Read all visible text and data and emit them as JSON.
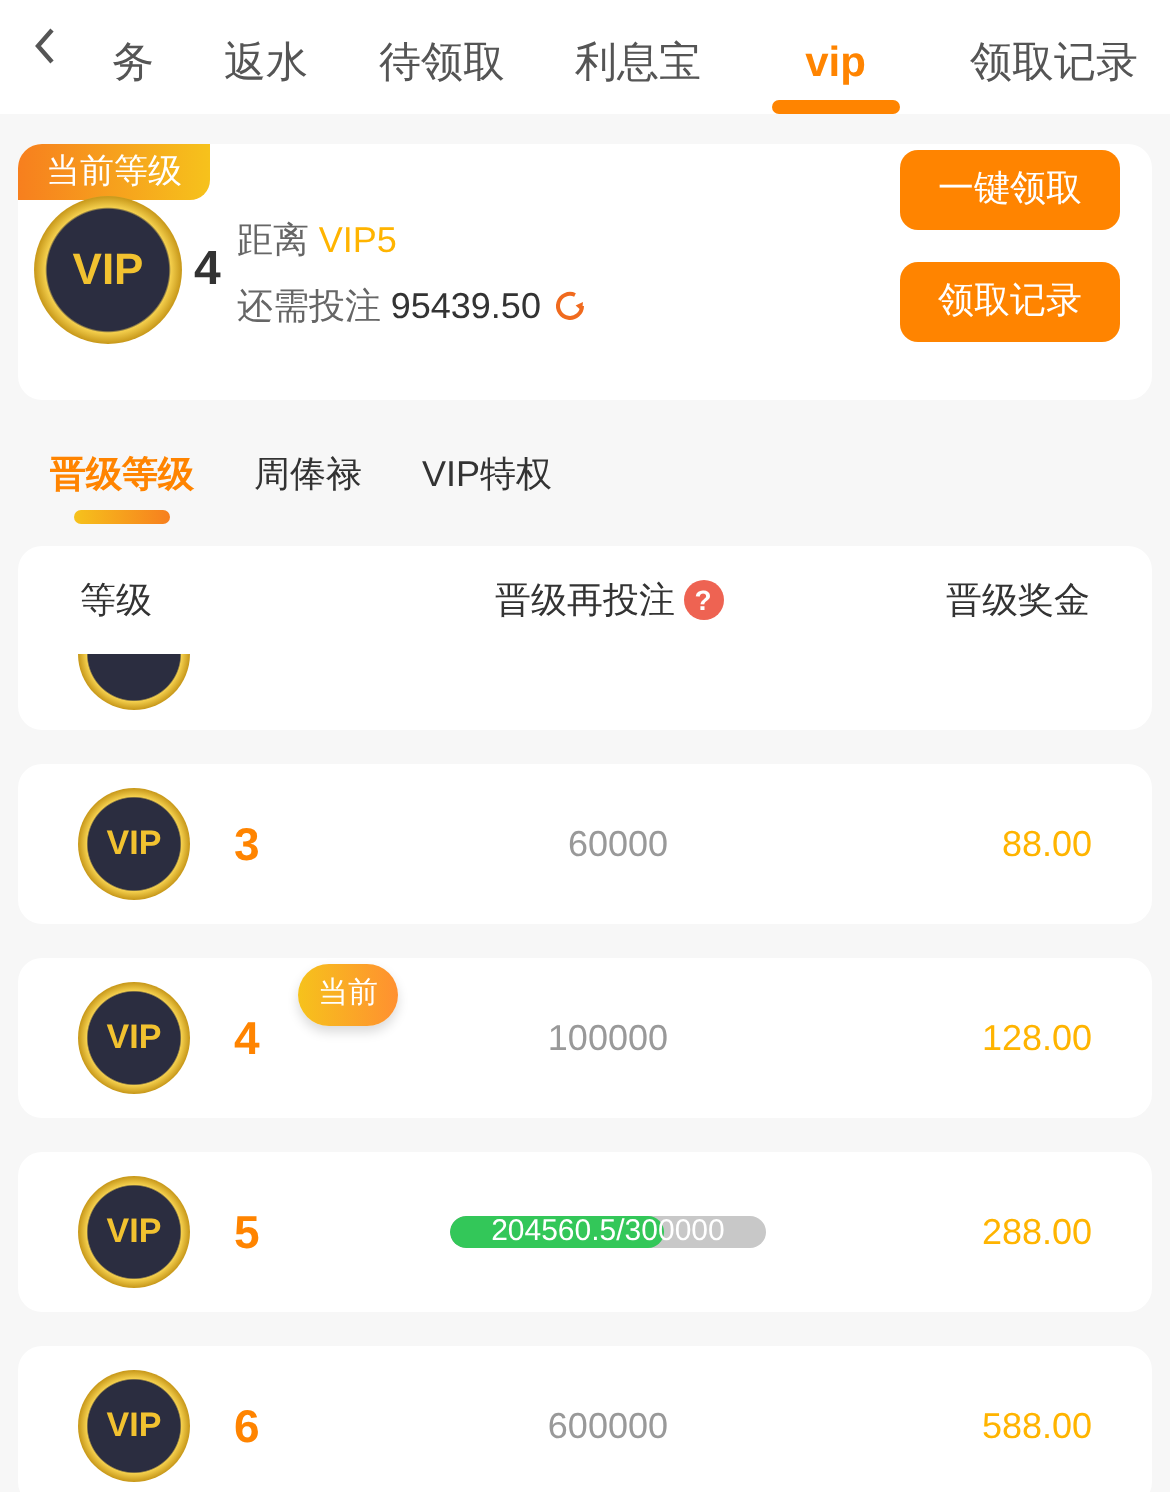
{
  "nav": {
    "tabs": [
      {
        "label": "务",
        "selected": false
      },
      {
        "label": "返水",
        "selected": false
      },
      {
        "label": "待领取",
        "selected": false
      },
      {
        "label": "利息宝",
        "selected": false
      },
      {
        "label": "vip",
        "selected": true
      },
      {
        "label": "领取记录",
        "selected": false
      }
    ]
  },
  "current": {
    "badge": "当前等级",
    "medal": "VIP",
    "level": "4",
    "distance_label": "距离",
    "next_level": "VIP5",
    "need_label": "还需投注",
    "need_amount": "95439.50"
  },
  "buttons": [
    "一键领取",
    "领取记录"
  ],
  "subtabs": [
    {
      "label": "晋级等级",
      "selected": true
    },
    {
      "label": "周俸禄",
      "selected": false
    },
    {
      "label": "VIP特权",
      "selected": false
    }
  ],
  "table": {
    "columns": [
      "等级",
      "晋级再投注",
      "晋级奖金"
    ],
    "help": "?",
    "rows": [
      {
        "kind": "partial"
      },
      {
        "kind": "plain",
        "medal": "VIP",
        "level": "3",
        "requirement": "60000",
        "bonus": "88.00"
      },
      {
        "kind": "plain",
        "medal": "VIP",
        "level": "4",
        "badge": "当前",
        "requirement": "100000",
        "bonus": "128.00"
      },
      {
        "kind": "progress",
        "medal": "VIP",
        "level": "5",
        "progress_text": "204560.5/300000",
        "progress": {
          "level": 0.68
        },
        "bonus": "288.00"
      },
      {
        "kind": "plain",
        "medal": "VIP",
        "level": "6",
        "requirement": "600000",
        "bonus": "588.00"
      }
    ]
  }
}
